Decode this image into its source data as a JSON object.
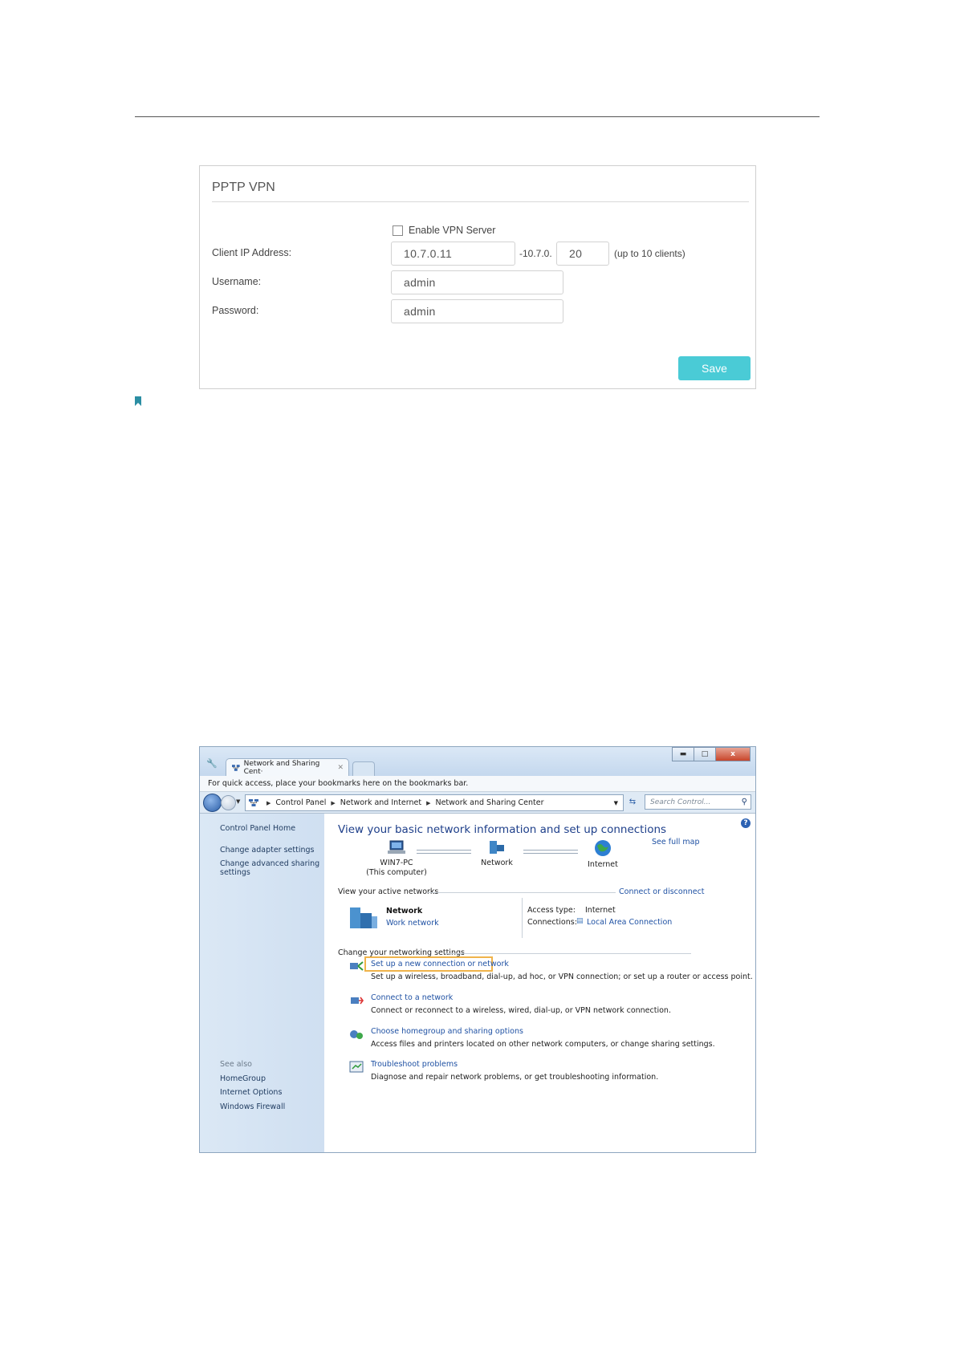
{
  "vpn": {
    "title": "PPTP VPN",
    "enable_label": "Enable VPN Server",
    "client_ip_label": "Client IP Address:",
    "ip_start": "10.7.0.11",
    "ip_range_sep": "-10.7.0.",
    "ip_end": "20",
    "clients_note": "(up to 10 clients)",
    "username_label": "Username:",
    "username_value": "admin",
    "password_label": "Password:",
    "password_value": "admin",
    "save_label": "Save",
    "accent_color": "#4acbd6"
  },
  "browser": {
    "tab_title": "Network and Sharing Cent·",
    "bookmarks_hint": "For quick access, place your bookmarks here on the bookmarks bar.",
    "breadcrumb": [
      "Control Panel",
      "Network and Internet",
      "Network and Sharing Center"
    ],
    "search_placeholder": "Search Control...",
    "close_glyph": "x"
  },
  "sidebar": {
    "home": "Control Panel Home",
    "adapter": "Change adapter settings",
    "advanced_1": "Change advanced sharing",
    "advanced_2": "settings",
    "see_also": "See also",
    "links": [
      "HomeGroup",
      "Internet Options",
      "Windows Firewall"
    ]
  },
  "content": {
    "heading": "View your basic network information and set up connections",
    "see_full_map": "See full map",
    "nodes": {
      "pc": "WIN7-PC",
      "pc_sub": "(This computer)",
      "network": "Network",
      "internet": "Internet"
    },
    "active_networks_title": "View your active networks",
    "connect_disconnect": "Connect or disconnect",
    "active": {
      "name": "Network",
      "type": "Work network",
      "access_label": "Access type:",
      "access_value": "Internet",
      "connections_label": "Connections:",
      "connections_value": "Local Area Connection"
    },
    "change_title": "Change your networking settings",
    "tasks": [
      {
        "link": "Set up a new connection or network",
        "desc": "Set up a wireless, broadband, dial-up, ad hoc, or VPN connection; or set up a router or access point."
      },
      {
        "link": "Connect to a network",
        "desc": "Connect or reconnect to a wireless, wired, dial-up, or VPN network connection."
      },
      {
        "link": "Choose homegroup and sharing options",
        "desc": "Access files and printers located on other network computers, or change sharing settings."
      },
      {
        "link": "Troubleshoot problems",
        "desc": "Diagnose and repair network problems, or get troubleshooting information."
      }
    ],
    "highlight_color": "#f0b34a"
  }
}
